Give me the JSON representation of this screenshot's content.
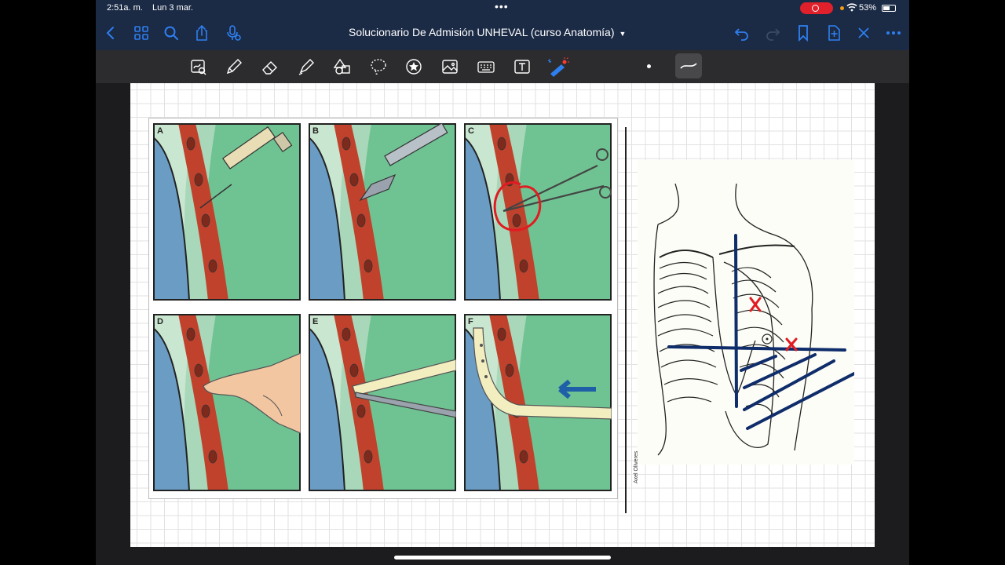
{
  "status_bar": {
    "time": "2:51a. m.",
    "date": "Lun 3 mar.",
    "battery": "53%"
  },
  "nav": {
    "title": "Solucionario De Admisión UNHEVAL (curso Anatomía)",
    "icons": [
      "back-chevron",
      "thumbnails",
      "search",
      "share",
      "microphone",
      "undo",
      "redo",
      "bookmark",
      "add-page",
      "close",
      "more"
    ]
  },
  "toolbar": {
    "tools": [
      "lasso-zoom",
      "pen",
      "eraser",
      "highlighter",
      "shapes",
      "lasso",
      "elements",
      "image",
      "keyboard",
      "text",
      "laser-pointer"
    ],
    "stroke_size": "small"
  },
  "figure": {
    "panels": [
      "A",
      "B",
      "C",
      "D",
      "E",
      "F"
    ],
    "credit": "Axel Oliveres"
  },
  "colors": {
    "nav_bg": "#1b2a45",
    "accent_blue": "#2e7ff0",
    "lung": "#6a9cc4",
    "pleura": "#c9e6d0",
    "muscle": "#c0422c",
    "tissue": "#6fc392",
    "annotation_red": "#e11b22",
    "annotation_navy": "#0f2d6b"
  }
}
